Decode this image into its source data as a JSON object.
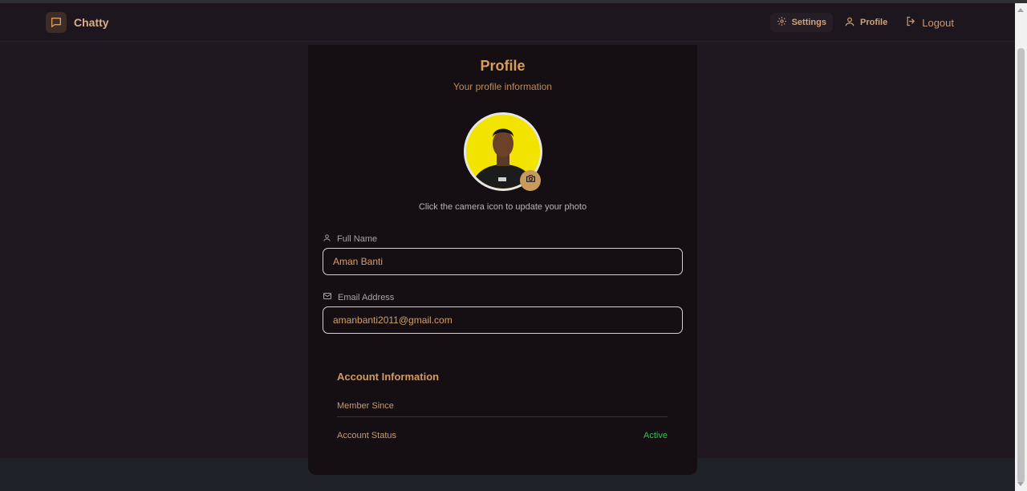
{
  "app": {
    "name": "Chatty",
    "logo_icon": "chat-bubble-icon",
    "accent_color": "#d79d5c",
    "active_color": "#33c24d"
  },
  "nav": {
    "settings_label": "Settings",
    "profile_label": "Profile",
    "logout_label": "Logout",
    "settings_icon": "gear-icon",
    "profile_icon": "user-icon",
    "logout_icon": "logout-icon"
  },
  "profile": {
    "title": "Profile",
    "subtitle": "Your profile information",
    "photo_hint": "Click the camera icon to update your photo",
    "camera_icon": "camera-icon"
  },
  "fields": {
    "full_name": {
      "label": "Full Name",
      "value": "Aman Banti",
      "icon": "user-icon"
    },
    "email": {
      "label": "Email Address",
      "value": "amanbanti2011@gmail.com",
      "icon": "mail-icon"
    }
  },
  "account": {
    "title": "Account Information",
    "member_since_label": "Member Since",
    "member_since_value": "",
    "status_label": "Account Status",
    "status_value": "Active"
  }
}
